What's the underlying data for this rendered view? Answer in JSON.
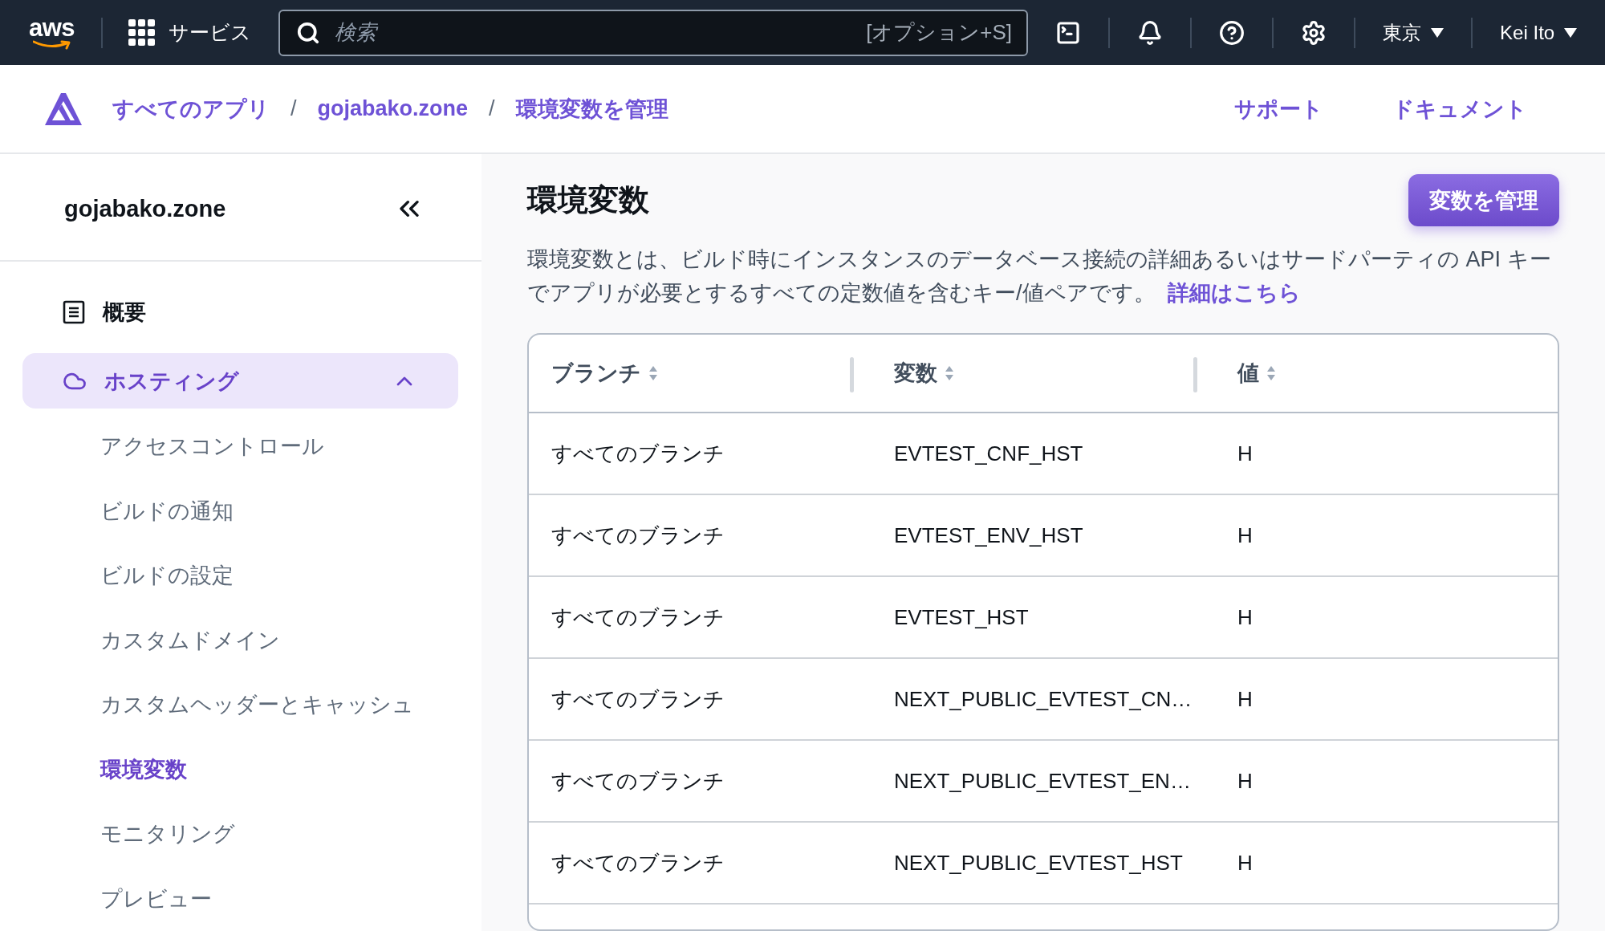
{
  "top_bar": {
    "logo": "aws",
    "services": "サービス",
    "search": {
      "placeholder": "検索",
      "shortcut": "[オプション+S]"
    },
    "region": "東京",
    "user": "Kei Ito"
  },
  "breadcrumb": {
    "items": [
      {
        "kind": "link",
        "text": "すべてのアプリ"
      },
      {
        "kind": "separator",
        "text": "/"
      },
      {
        "kind": "link",
        "text": "gojabako.zone"
      },
      {
        "kind": "separator",
        "text": "/"
      },
      {
        "kind": "link",
        "text": "環境変数を管理"
      }
    ],
    "links": [
      "サポート",
      "ドキュメント"
    ]
  },
  "sidebar": {
    "title": "gojabako.zone",
    "items": [
      {
        "label": "概要",
        "selected": false
      },
      {
        "label": "ホスティング",
        "selected": true,
        "expanded": true,
        "children": [
          {
            "label": "アクセスコントロール",
            "selected": false
          },
          {
            "label": "ビルドの通知",
            "selected": false
          },
          {
            "label": "ビルドの設定",
            "selected": false
          },
          {
            "label": "カスタムドメイン",
            "selected": false
          },
          {
            "label": "カスタムヘッダーとキャッシュ",
            "selected": false
          },
          {
            "label": "環境変数",
            "selected": true
          },
          {
            "label": "モニタリング",
            "selected": false
          },
          {
            "label": "プレビュー",
            "selected": false
          }
        ]
      }
    ]
  },
  "page": {
    "title": "環境変数",
    "action": "変数を管理",
    "description": "環境変数とは、ビルド時にインスタンスのデータベース接続の詳細あるいはサードパーティの API キーでアプリが必要とするすべての定数値を含むキー/値ペアです。",
    "link": "詳細はこちら"
  },
  "table": {
    "columns": [
      "ブランチ",
      "変数",
      "値"
    ],
    "rows": [
      [
        "すべてのブランチ",
        "EVTEST_CNF_HST",
        "H"
      ],
      [
        "すべてのブランチ",
        "EVTEST_ENV_HST",
        "H"
      ],
      [
        "すべてのブランチ",
        "EVTEST_HST",
        "H"
      ],
      [
        "すべてのブランチ",
        "NEXT_PUBLIC_EVTEST_CN…",
        "H"
      ],
      [
        "すべてのブランチ",
        "NEXT_PUBLIC_EVTEST_EN…",
        "H"
      ],
      [
        "すべてのブランチ",
        "NEXT_PUBLIC_EVTEST_HST",
        "H"
      ]
    ]
  }
}
